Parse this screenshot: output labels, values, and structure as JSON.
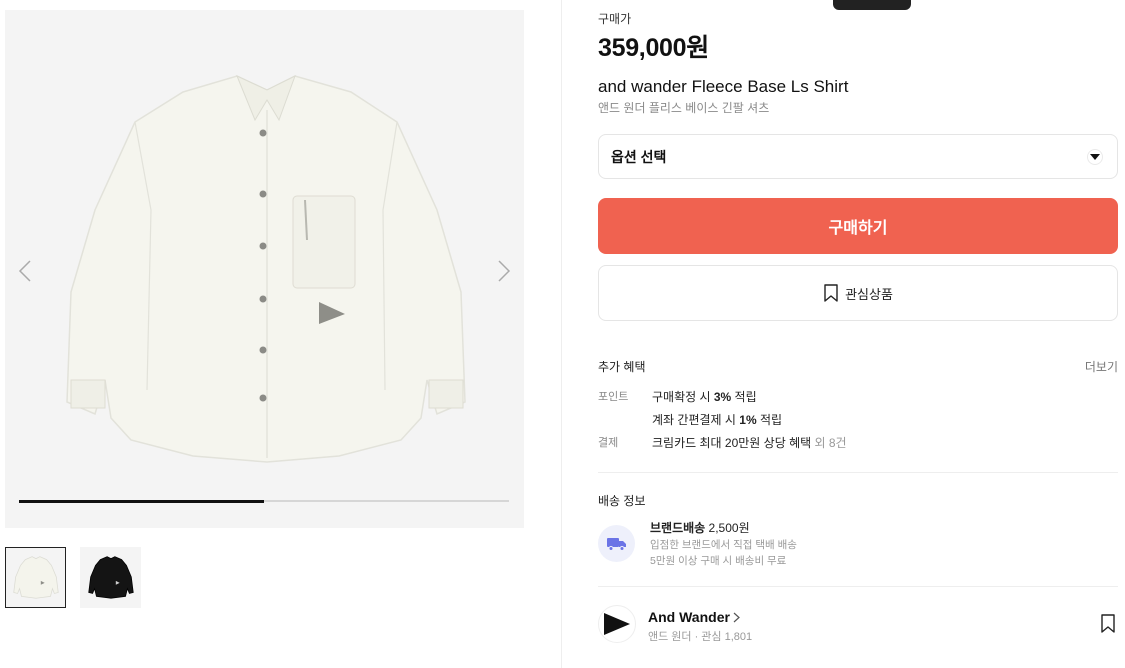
{
  "product": {
    "price_label": "구매가",
    "price": "359,000원",
    "name_en": "and wander Fleece Base Ls Shirt",
    "name_ko": "앤드 원더 플리스 베이스 긴팔 셔츠"
  },
  "gallery": {
    "progress": 0.5,
    "thumbnails": [
      "white-shirt",
      "black-shirt"
    ]
  },
  "option": {
    "label": "옵션 선택"
  },
  "actions": {
    "buy_label": "구매하기",
    "wish_label": "관심상품"
  },
  "benefits": {
    "title": "추가 혜택",
    "more": "더보기",
    "point_tag": "포인트",
    "point_line1_pre": "구매확정 시 ",
    "point_line1_bold": "3%",
    "point_line1_post": " 적립",
    "point_line2_pre": "계좌 간편결제 시 ",
    "point_line2_bold": "1%",
    "point_line2_post": " 적립",
    "pay_tag": "결제",
    "pay_line": "크림카드 최대 20만원 상당 혜택",
    "pay_extra": " 외 8건"
  },
  "shipping": {
    "title": "배송 정보",
    "method_bold": "브랜드배송",
    "method_price": " 2,500원",
    "line1": "입점한 브랜드에서 직접 택배 배송",
    "line2": "5만원 이상 구매 시 배송비 무료"
  },
  "brand": {
    "name": "And Wander",
    "meta": "앤드 원더 · 관심 1,801"
  },
  "icons": [
    "chevron-left-icon",
    "chevron-right-icon",
    "chevron-down-icon",
    "bookmark-icon",
    "truck-icon",
    "brand-logo-icon"
  ]
}
